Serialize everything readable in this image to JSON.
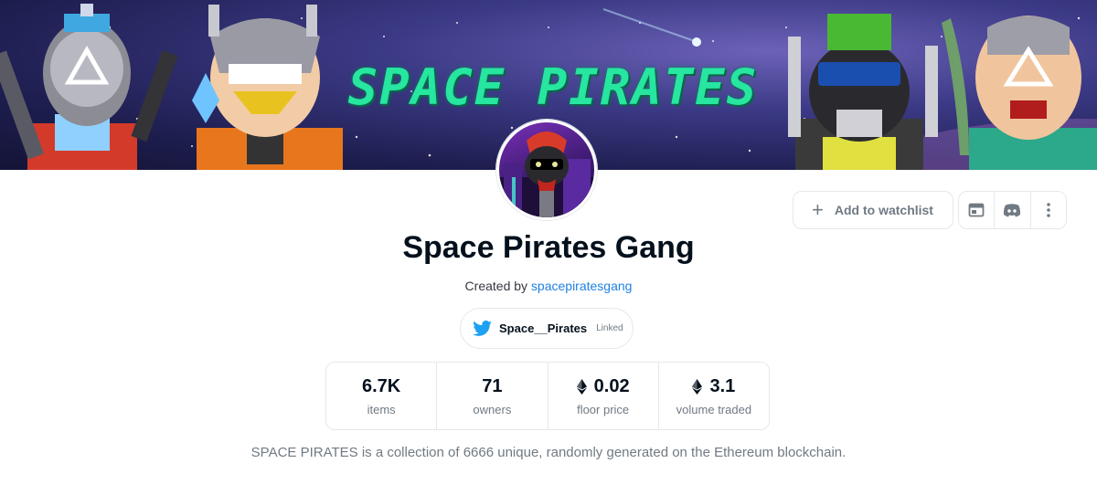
{
  "banner": {
    "title": "SPACE PIRATES"
  },
  "actions": {
    "watchlist_label": "Add to watchlist",
    "website_icon": "browser-window-icon",
    "discord_icon": "discord-icon",
    "more_icon": "vertical-dots-icon"
  },
  "collection": {
    "name": "Space Pirates Gang",
    "created_by_prefix": "Created by",
    "creator": "spacepiratesgang",
    "description": "SPACE PIRATES is a collection of 6666 unique, randomly generated on the Ethereum blockchain."
  },
  "twitter": {
    "icon": "twitter-bird-icon",
    "handle": "Space__Pirates",
    "status": "Linked"
  },
  "stats": [
    {
      "value": "6.7K",
      "label": "items",
      "eth": false
    },
    {
      "value": "71",
      "label": "owners",
      "eth": false
    },
    {
      "value": "0.02",
      "label": "floor price",
      "eth": true
    },
    {
      "value": "3.1",
      "label": "volume traded",
      "eth": true
    }
  ],
  "colors": {
    "link": "#2081e2",
    "banner_title": "#26e6a0",
    "twitter": "#1da1f2"
  }
}
